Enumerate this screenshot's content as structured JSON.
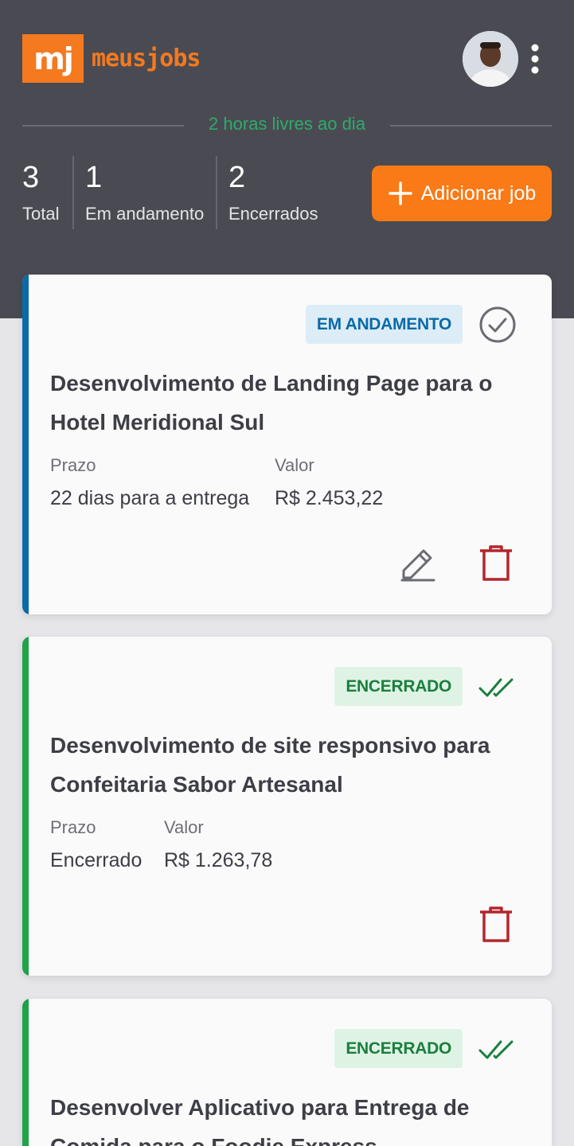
{
  "header": {
    "logo_mark": "mj",
    "logo_text": "meusjobs",
    "free_hours": "2 horas livres ao dia",
    "stats": [
      {
        "value": "3",
        "label": "Total"
      },
      {
        "value": "1",
        "label": "Em andamento"
      },
      {
        "value": "2",
        "label": "Encerrados"
      }
    ],
    "add_button_label": "Adicionar job",
    "avatar_icon": "user-avatar",
    "menu_icon": "kebab-menu-icon"
  },
  "jobs": [
    {
      "status": "EM ANDAMENTO",
      "title": "Desenvolvimento de Landing Page para o Hotel Meridional Sul",
      "deadline_label": "Prazo",
      "deadline": "22 dias para a entrega",
      "value_label": "Valor",
      "value": "R$ 2.453,22"
    },
    {
      "status": "ENCERRADO",
      "title": "Desenvolvimento de site responsivo para Confeitaria Sabor Artesanal",
      "deadline_label": "Prazo",
      "deadline": "Encerrado",
      "value_label": "Valor",
      "value": "R$ 1.263,78"
    },
    {
      "status": "ENCERRADO",
      "title": "Desenvolver Aplicativo para Entrega de Comida para o Foodie Express"
    }
  ],
  "colors": {
    "header_bg": "#4a4b52",
    "brand_orange": "#f97a16",
    "in_progress_blue": "#0b6aa8",
    "closed_green": "#1fa24a",
    "delete_red": "#b3262c"
  }
}
